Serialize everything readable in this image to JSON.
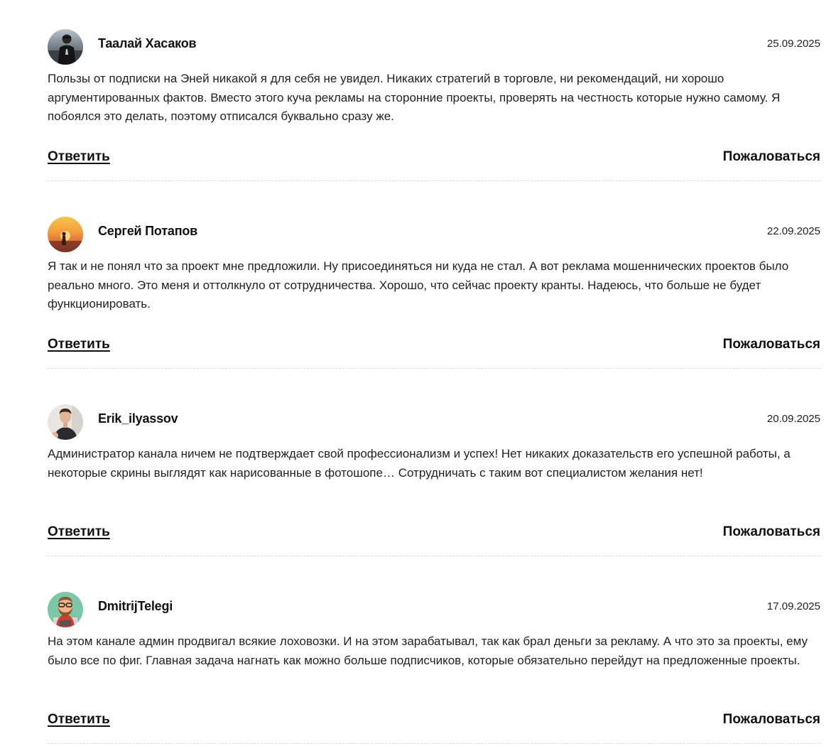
{
  "comments": [
    {
      "author": "Таалай Хасаков",
      "date": "25.09.2025",
      "text": "Пользы от подписки на Эней никакой я для себя не увидел. Никаких стратегий в торговле, ни рекомендаций, ни хорошо аргументированных фактов. Вместо этого куча рекламы на сторонние проекты, проверять на честность которые нужно самому. Я побоялся это делать, поэтому отписался буквально сразу же.",
      "reply_label": "Ответить",
      "report_label": "Пожаловаться",
      "avatar": "photo-man-dark-background"
    },
    {
      "author": "Сергей Потапов",
      "date": "22.09.2025",
      "text": "Я так и не понял что за проект мне предложили. Ну присоединяться ни куда не стал. А вот реклама мошеннических проектов было реально много. Это меня и оттолкнуло от сотрудничества. Хорошо, что сейчас проекту кранты. Надеюсь, что больше не будет функционировать.",
      "reply_label": "Ответить",
      "report_label": "Пожаловаться",
      "avatar": "photo-sunset-figure"
    },
    {
      "author": "Erik_ilyassov",
      "date": "20.09.2025",
      "text": "Администратор канала ничем не подтверждает свой профессионализм и успех! Нет никаких доказательств его успешной работы, а некоторые скрины выглядят как нарисованные в фотошопе… Сотрудничать с таким вот специалистом желания нет!",
      "reply_label": "Ответить",
      "report_label": "Пожаловаться",
      "avatar": "photo-man-light-background"
    },
    {
      "author": "DmitrijTelegi",
      "date": "17.09.2025",
      "text": "На этом канале админ продвигал всякие лоховозки. И на этом зарабатывал, так как брал деньги за рекламу. А что это за проекты, ему было все по фиг. Главная задача нагнать как можно больше подписчиков, которые обязательно перейдут на предложенные проекты.",
      "reply_label": "Ответить",
      "report_label": "Пожаловаться",
      "avatar": "cartoon-bearded-man-green-background"
    }
  ]
}
